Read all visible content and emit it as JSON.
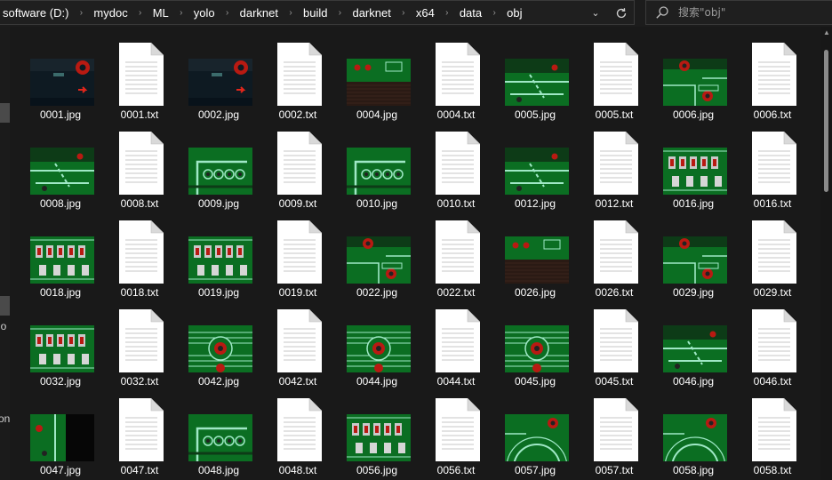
{
  "address_bar": {
    "path": [
      "software (D:)",
      "mydoc",
      "ML",
      "yolo",
      "darknet",
      "build",
      "darknet",
      "x64",
      "data",
      "obj"
    ]
  },
  "search": {
    "placeholder": "搜索\"obj\""
  },
  "nav_pane": {
    "fragments": [
      "io",
      "on"
    ]
  },
  "colors": {
    "background": "#191919",
    "pcb_green": "#0b6e22",
    "pcb_dark": "#0d3b17",
    "trace": "#9fe8c6",
    "pad_red": "#b81a12"
  },
  "files": [
    {
      "name": "0001.jpg",
      "kind": "image",
      "style": "dark-red"
    },
    {
      "name": "0001.txt",
      "kind": "text"
    },
    {
      "name": "0002.jpg",
      "kind": "image",
      "style": "dark-red"
    },
    {
      "name": "0002.txt",
      "kind": "text"
    },
    {
      "name": "0004.jpg",
      "kind": "image",
      "style": "board-dark"
    },
    {
      "name": "0004.txt",
      "kind": "text"
    },
    {
      "name": "0005.jpg",
      "kind": "image",
      "style": "traces"
    },
    {
      "name": "0005.txt",
      "kind": "text"
    },
    {
      "name": "0006.jpg",
      "kind": "image",
      "style": "pads"
    },
    {
      "name": "0006.txt",
      "kind": "text"
    },
    {
      "name": "0008.jpg",
      "kind": "image",
      "style": "traces"
    },
    {
      "name": "0008.txt",
      "kind": "text"
    },
    {
      "name": "0009.jpg",
      "kind": "image",
      "style": "pins"
    },
    {
      "name": "0009.txt",
      "kind": "text"
    },
    {
      "name": "0010.jpg",
      "kind": "image",
      "style": "pins"
    },
    {
      "name": "0010.txt",
      "kind": "text"
    },
    {
      "name": "0012.jpg",
      "kind": "image",
      "style": "traces"
    },
    {
      "name": "0012.txt",
      "kind": "text"
    },
    {
      "name": "0016.jpg",
      "kind": "image",
      "style": "components"
    },
    {
      "name": "0016.txt",
      "kind": "text"
    },
    {
      "name": "0018.jpg",
      "kind": "image",
      "style": "components"
    },
    {
      "name": "0018.txt",
      "kind": "text"
    },
    {
      "name": "0019.jpg",
      "kind": "image",
      "style": "components"
    },
    {
      "name": "0019.txt",
      "kind": "text"
    },
    {
      "name": "0022.jpg",
      "kind": "image",
      "style": "pads"
    },
    {
      "name": "0022.txt",
      "kind": "text"
    },
    {
      "name": "0026.jpg",
      "kind": "image",
      "style": "board-dark"
    },
    {
      "name": "0026.txt",
      "kind": "text"
    },
    {
      "name": "0029.jpg",
      "kind": "image",
      "style": "pads"
    },
    {
      "name": "0029.txt",
      "kind": "text"
    },
    {
      "name": "0032.jpg",
      "kind": "image",
      "style": "components"
    },
    {
      "name": "0032.txt",
      "kind": "text"
    },
    {
      "name": "0042.jpg",
      "kind": "image",
      "style": "ring"
    },
    {
      "name": "0042.txt",
      "kind": "text"
    },
    {
      "name": "0044.jpg",
      "kind": "image",
      "style": "ring"
    },
    {
      "name": "0044.txt",
      "kind": "text"
    },
    {
      "name": "0045.jpg",
      "kind": "image",
      "style": "ring"
    },
    {
      "name": "0045.txt",
      "kind": "text"
    },
    {
      "name": "0046.jpg",
      "kind": "image",
      "style": "traces"
    },
    {
      "name": "0046.txt",
      "kind": "text"
    },
    {
      "name": "0047.jpg",
      "kind": "image",
      "style": "half-dark"
    },
    {
      "name": "0047.txt",
      "kind": "text"
    },
    {
      "name": "0048.jpg",
      "kind": "image",
      "style": "pins"
    },
    {
      "name": "0048.txt",
      "kind": "text"
    },
    {
      "name": "0056.jpg",
      "kind": "image",
      "style": "components"
    },
    {
      "name": "0056.txt",
      "kind": "text"
    },
    {
      "name": "0057.jpg",
      "kind": "image",
      "style": "arcs"
    },
    {
      "name": "0057.txt",
      "kind": "text"
    },
    {
      "name": "0058.jpg",
      "kind": "image",
      "style": "arcs"
    },
    {
      "name": "0058.txt",
      "kind": "text"
    }
  ]
}
